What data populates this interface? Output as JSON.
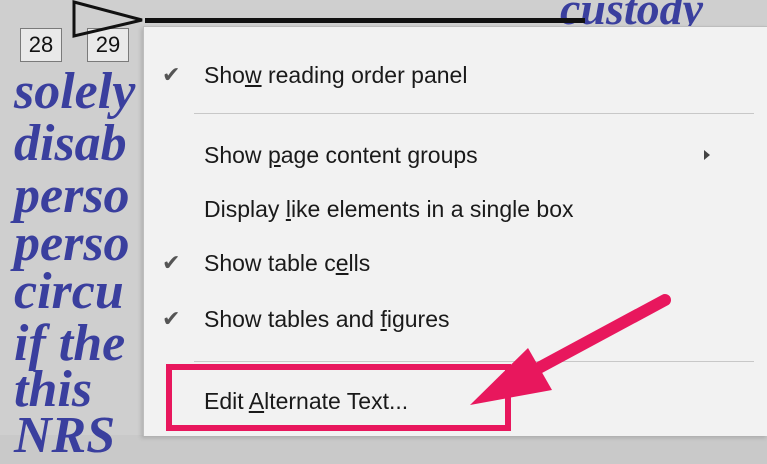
{
  "document": {
    "top_text": "custody",
    "lines": [
      "solely",
      "disab",
      "perso",
      "perso",
      "circu",
      "if the",
      "this",
      "NRS"
    ]
  },
  "tags": [
    "28",
    "29"
  ],
  "menu": {
    "items": [
      {
        "pre": "Sho",
        "u": "w",
        "post": " reading order panel",
        "checked": true
      },
      {
        "pre": "Show ",
        "u": "p",
        "post": "age content groups",
        "checked": false,
        "submenu": true
      },
      {
        "pre": "Display ",
        "u": "l",
        "post": "ike elements in a single box",
        "checked": false
      },
      {
        "pre": "Show table c",
        "u": "e",
        "post": "lls",
        "checked": true
      },
      {
        "pre": "Show tables and ",
        "u": "f",
        "post": "igures",
        "checked": true
      },
      {
        "pre": "Edit ",
        "u": "A",
        "post": "lternate Text...",
        "checked": false
      }
    ],
    "check_glyph": "✔"
  },
  "annotation": {
    "color": "#e8175d"
  }
}
